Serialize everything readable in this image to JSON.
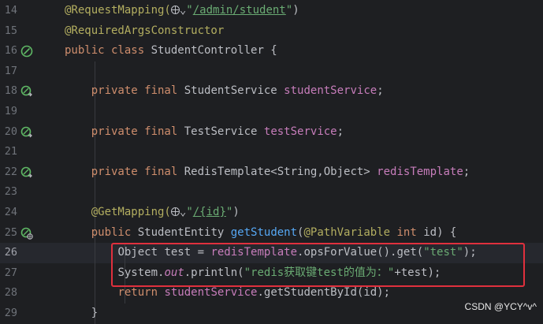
{
  "editor": {
    "lines": [
      {
        "num": "14",
        "gutter": "",
        "current": false,
        "tokens": [
          {
            "t": "@RequestMapping(",
            "c": "ann"
          },
          {
            "t": "",
            "c": "globe"
          },
          {
            "t": "⌄",
            "c": "plain"
          },
          {
            "t": "\"",
            "c": "str"
          },
          {
            "t": "/admin/student",
            "c": "url"
          },
          {
            "t": "\"",
            "c": "str"
          },
          {
            "t": ")",
            "c": "plain"
          }
        ]
      },
      {
        "num": "15",
        "gutter": "",
        "current": false,
        "tokens": [
          {
            "t": "@RequiredArgsConstructor",
            "c": "ann"
          }
        ]
      },
      {
        "num": "16",
        "gutter": "bean-icon",
        "current": false,
        "tokens": [
          {
            "t": "public class ",
            "c": "kw"
          },
          {
            "t": "StudentController {",
            "c": "plain"
          }
        ]
      },
      {
        "num": "17",
        "gutter": "",
        "current": false,
        "tokens": []
      },
      {
        "num": "18",
        "gutter": "autowired-icon",
        "current": false,
        "tokens": [
          {
            "t": "    "
          },
          {
            "t": "private final ",
            "c": "kw"
          },
          {
            "t": "StudentService ",
            "c": "plain"
          },
          {
            "t": "studentService",
            "c": "fld"
          },
          {
            "t": ";",
            "c": "plain"
          }
        ]
      },
      {
        "num": "19",
        "gutter": "",
        "current": false,
        "tokens": []
      },
      {
        "num": "20",
        "gutter": "autowired-icon",
        "current": false,
        "tokens": [
          {
            "t": "    "
          },
          {
            "t": "private final ",
            "c": "kw"
          },
          {
            "t": "TestService ",
            "c": "plain"
          },
          {
            "t": "testService",
            "c": "fld"
          },
          {
            "t": ";",
            "c": "plain"
          }
        ]
      },
      {
        "num": "21",
        "gutter": "",
        "current": false,
        "tokens": []
      },
      {
        "num": "22",
        "gutter": "autowired-icon",
        "current": false,
        "tokens": [
          {
            "t": "    "
          },
          {
            "t": "private final ",
            "c": "kw"
          },
          {
            "t": "RedisTemplate<String,Object> ",
            "c": "plain"
          },
          {
            "t": "redisTemplate",
            "c": "fld"
          },
          {
            "t": ";",
            "c": "plain"
          }
        ]
      },
      {
        "num": "23",
        "gutter": "",
        "current": false,
        "tokens": []
      },
      {
        "num": "24",
        "gutter": "",
        "current": false,
        "tokens": [
          {
            "t": "    "
          },
          {
            "t": "@GetMapping(",
            "c": "ann"
          },
          {
            "t": "",
            "c": "globe"
          },
          {
            "t": "⌄",
            "c": "plain"
          },
          {
            "t": "\"",
            "c": "str"
          },
          {
            "t": "/{id}",
            "c": "url"
          },
          {
            "t": "\"",
            "c": "str"
          },
          {
            "t": ")",
            "c": "plain"
          }
        ]
      },
      {
        "num": "25",
        "gutter": "endpoint-icon",
        "current": false,
        "tokens": [
          {
            "t": "    "
          },
          {
            "t": "public ",
            "c": "kw"
          },
          {
            "t": "StudentEntity ",
            "c": "plain"
          },
          {
            "t": "getStudent",
            "c": "mth"
          },
          {
            "t": "(",
            "c": "plain"
          },
          {
            "t": "@PathVariable ",
            "c": "ann"
          },
          {
            "t": "int ",
            "c": "kw"
          },
          {
            "t": "id) {",
            "c": "plain"
          }
        ]
      },
      {
        "num": "26",
        "gutter": "",
        "current": true,
        "tokens": [
          {
            "t": "        "
          },
          {
            "t": "Object test = ",
            "c": "plain"
          },
          {
            "t": "redisTemplate",
            "c": "fld"
          },
          {
            "t": ".opsForValue().get(",
            "c": "plain"
          },
          {
            "t": "\"test\"",
            "c": "str"
          },
          {
            "t": ");",
            "c": "plain"
          }
        ]
      },
      {
        "num": "27",
        "gutter": "",
        "current": false,
        "tokens": [
          {
            "t": "        "
          },
          {
            "t": "System.",
            "c": "plain"
          },
          {
            "t": "out",
            "c": "static"
          },
          {
            "t": ".println(",
            "c": "plain"
          },
          {
            "t": "\"redis获取键test的值为：\"",
            "c": "str"
          },
          {
            "t": "+test);",
            "c": "plain"
          }
        ]
      },
      {
        "num": "28",
        "gutter": "",
        "current": false,
        "tokens": [
          {
            "t": "        "
          },
          {
            "t": "return ",
            "c": "kw"
          },
          {
            "t": "studentService",
            "c": "fld"
          },
          {
            "t": ".getStudentById(id);",
            "c": "plain"
          }
        ]
      },
      {
        "num": "29",
        "gutter": "",
        "current": false,
        "tokens": [
          {
            "t": "    "
          },
          {
            "t": "}",
            "c": "plain"
          }
        ]
      }
    ]
  },
  "watermark": "CSDN @YCY^v^",
  "colors": {
    "background": "#1e1f22",
    "highlight_border": "#e0303d"
  }
}
